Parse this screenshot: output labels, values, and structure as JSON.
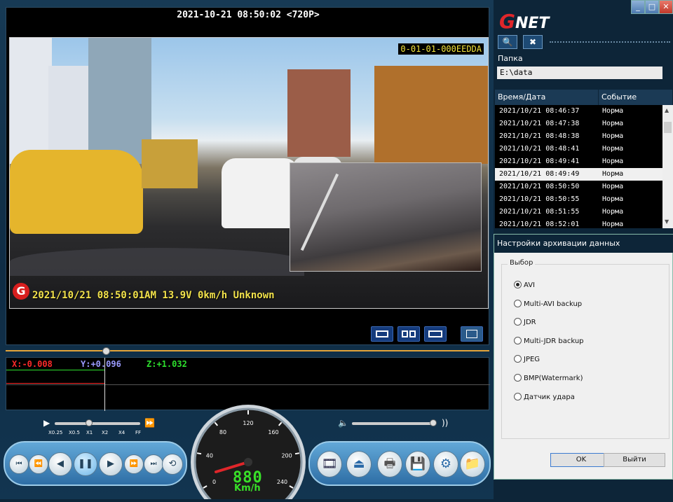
{
  "video": {
    "header": "2021-10-21 08:50:02 <720P>",
    "camera_id": "0-01-01-000EEDDA",
    "osd_text": "2021/10/21 08:50:01AM 13.9V   0km/h Unknown",
    "osd_logo": "G"
  },
  "gsensor": {
    "x": "X:-0.008",
    "y": "Y:+0.096",
    "z": "Z:+1.032",
    "x_color": "#ff2a2a",
    "y_color": "#9b9bff",
    "z_color": "#2ee02e"
  },
  "speed_labels": [
    "X0.25",
    "X0.5",
    "X1",
    "X2",
    "X4",
    "FF"
  ],
  "gauge": {
    "ticks": [
      "0",
      "40",
      "80",
      "120",
      "160",
      "200",
      "240"
    ],
    "digits": "880",
    "unit": "Km/h"
  },
  "app": {
    "logo_g": "G",
    "logo_rest": "NET"
  },
  "window_buttons": {
    "minimize": "_",
    "maximize": "□",
    "close": "✕"
  },
  "folder": {
    "label": "Папка",
    "path": "E:\\data"
  },
  "list": {
    "col_time": "Время/Дата",
    "col_event": "Событие",
    "rows": [
      {
        "time": "2021/10/21 08:46:37",
        "event": "Норма"
      },
      {
        "time": "2021/10/21 08:47:38",
        "event": "Норма"
      },
      {
        "time": "2021/10/21 08:48:38",
        "event": "Норма"
      },
      {
        "time": "2021/10/21 08:48:41",
        "event": "Норма"
      },
      {
        "time": "2021/10/21 08:49:41",
        "event": "Норма"
      },
      {
        "time": "2021/10/21 08:49:49",
        "event": "Норма"
      },
      {
        "time": "2021/10/21 08:50:50",
        "event": "Норма"
      },
      {
        "time": "2021/10/21 08:50:55",
        "event": "Норма"
      },
      {
        "time": "2021/10/21 08:51:55",
        "event": "Норма"
      },
      {
        "time": "2021/10/21 08:52:01",
        "event": "Норма"
      }
    ],
    "selected_index": 5
  },
  "dialog": {
    "title": "Настройки архивации данных",
    "group_label": "Выбор",
    "options": [
      "AVI",
      "Multi-AVI backup",
      "JDR",
      "Multi-JDR backup",
      "JPEG",
      "BMP(Watermark)",
      "Датчик удара"
    ],
    "selected_option": 0,
    "ok": "OK",
    "exit": "Выйти"
  }
}
